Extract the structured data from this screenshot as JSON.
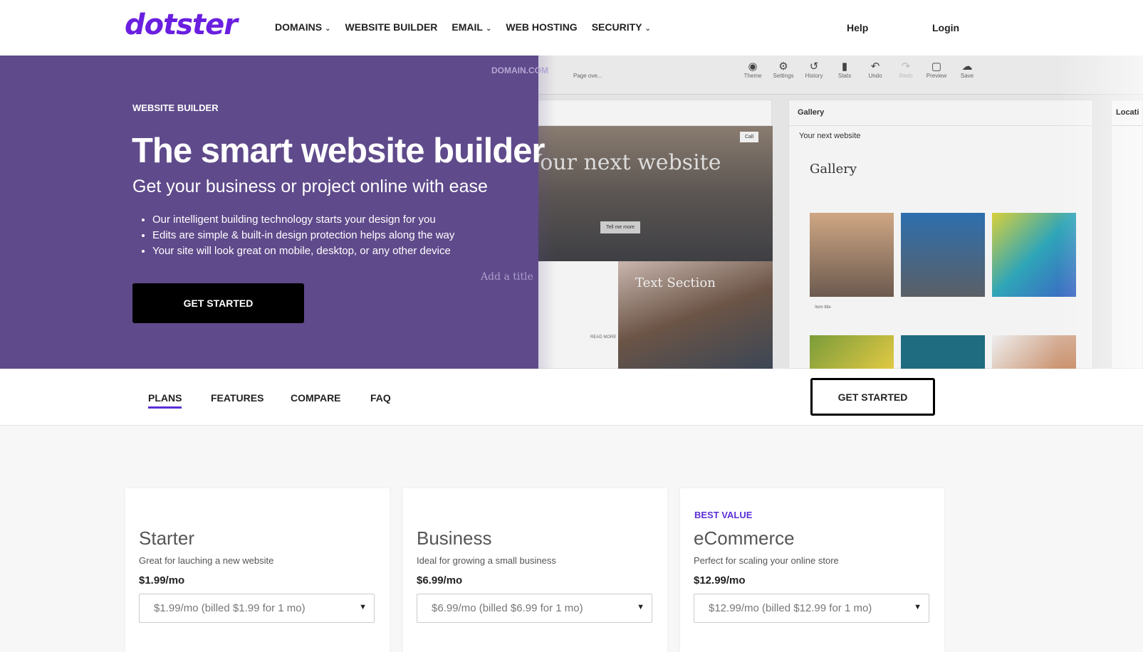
{
  "header": {
    "logo": "dotster",
    "nav": [
      {
        "label": "DOMAINS",
        "dropdown": true
      },
      {
        "label": "WEBSITE BUILDER",
        "dropdown": false
      },
      {
        "label": "EMAIL",
        "dropdown": true
      },
      {
        "label": "WEB HOSTING",
        "dropdown": false
      },
      {
        "label": "SECURITY",
        "dropdown": true
      }
    ],
    "help": "Help",
    "login": "Login"
  },
  "hero": {
    "eyebrow": "WEBSITE BUILDER",
    "title": "The smart website builder",
    "subtitle": "Get your business or project online with ease",
    "bullets": [
      "Our intelligent building technology starts your design for you",
      "Edits are simple & built-in design protection helps along the way",
      "Your site will look great on mobile, desktop, or any other device"
    ],
    "cta": "GET STARTED",
    "mockup": {
      "brand": "DOMAIN.COM",
      "page_select": "Page ove...",
      "toolbar": [
        "Theme",
        "Settings",
        "History",
        "Stats",
        "Undo",
        "Redo",
        "Preview",
        "Save"
      ],
      "site_title": "Your next website",
      "hero_button": "Tell me more",
      "call": "Call",
      "text_section": "Text Section",
      "add_title": "Add a title",
      "read_more": "READ MORE",
      "gallery_panel": "Gallery",
      "gallery_heading": "Gallery",
      "item_title": "Item title",
      "location_panel": "Locati"
    }
  },
  "subnav": {
    "tabs": [
      "PLANS",
      "FEATURES",
      "COMPARE",
      "FAQ"
    ],
    "active": "PLANS",
    "cta": "GET STARTED"
  },
  "plans": [
    {
      "badge": "",
      "name": "Starter",
      "desc": "Great for lauching a new website",
      "price": "$1.99/mo",
      "select": "$1.99/mo (billed $1.99 for 1 mo)"
    },
    {
      "badge": "",
      "name": "Business",
      "desc": "Ideal for growing a small business",
      "price": "$6.99/mo",
      "select": "$6.99/mo (billed $6.99 for 1 mo)"
    },
    {
      "badge": "BEST VALUE",
      "name": "eCommerce",
      "desc": "Perfect for scaling your online store",
      "price": "$12.99/mo",
      "select": "$12.99/mo (billed $12.99 for 1 mo)"
    }
  ],
  "colors": {
    "brand": "#6a1fe0",
    "hero_purple": "#5f4a8b",
    "accent": "#5a2fd6"
  }
}
